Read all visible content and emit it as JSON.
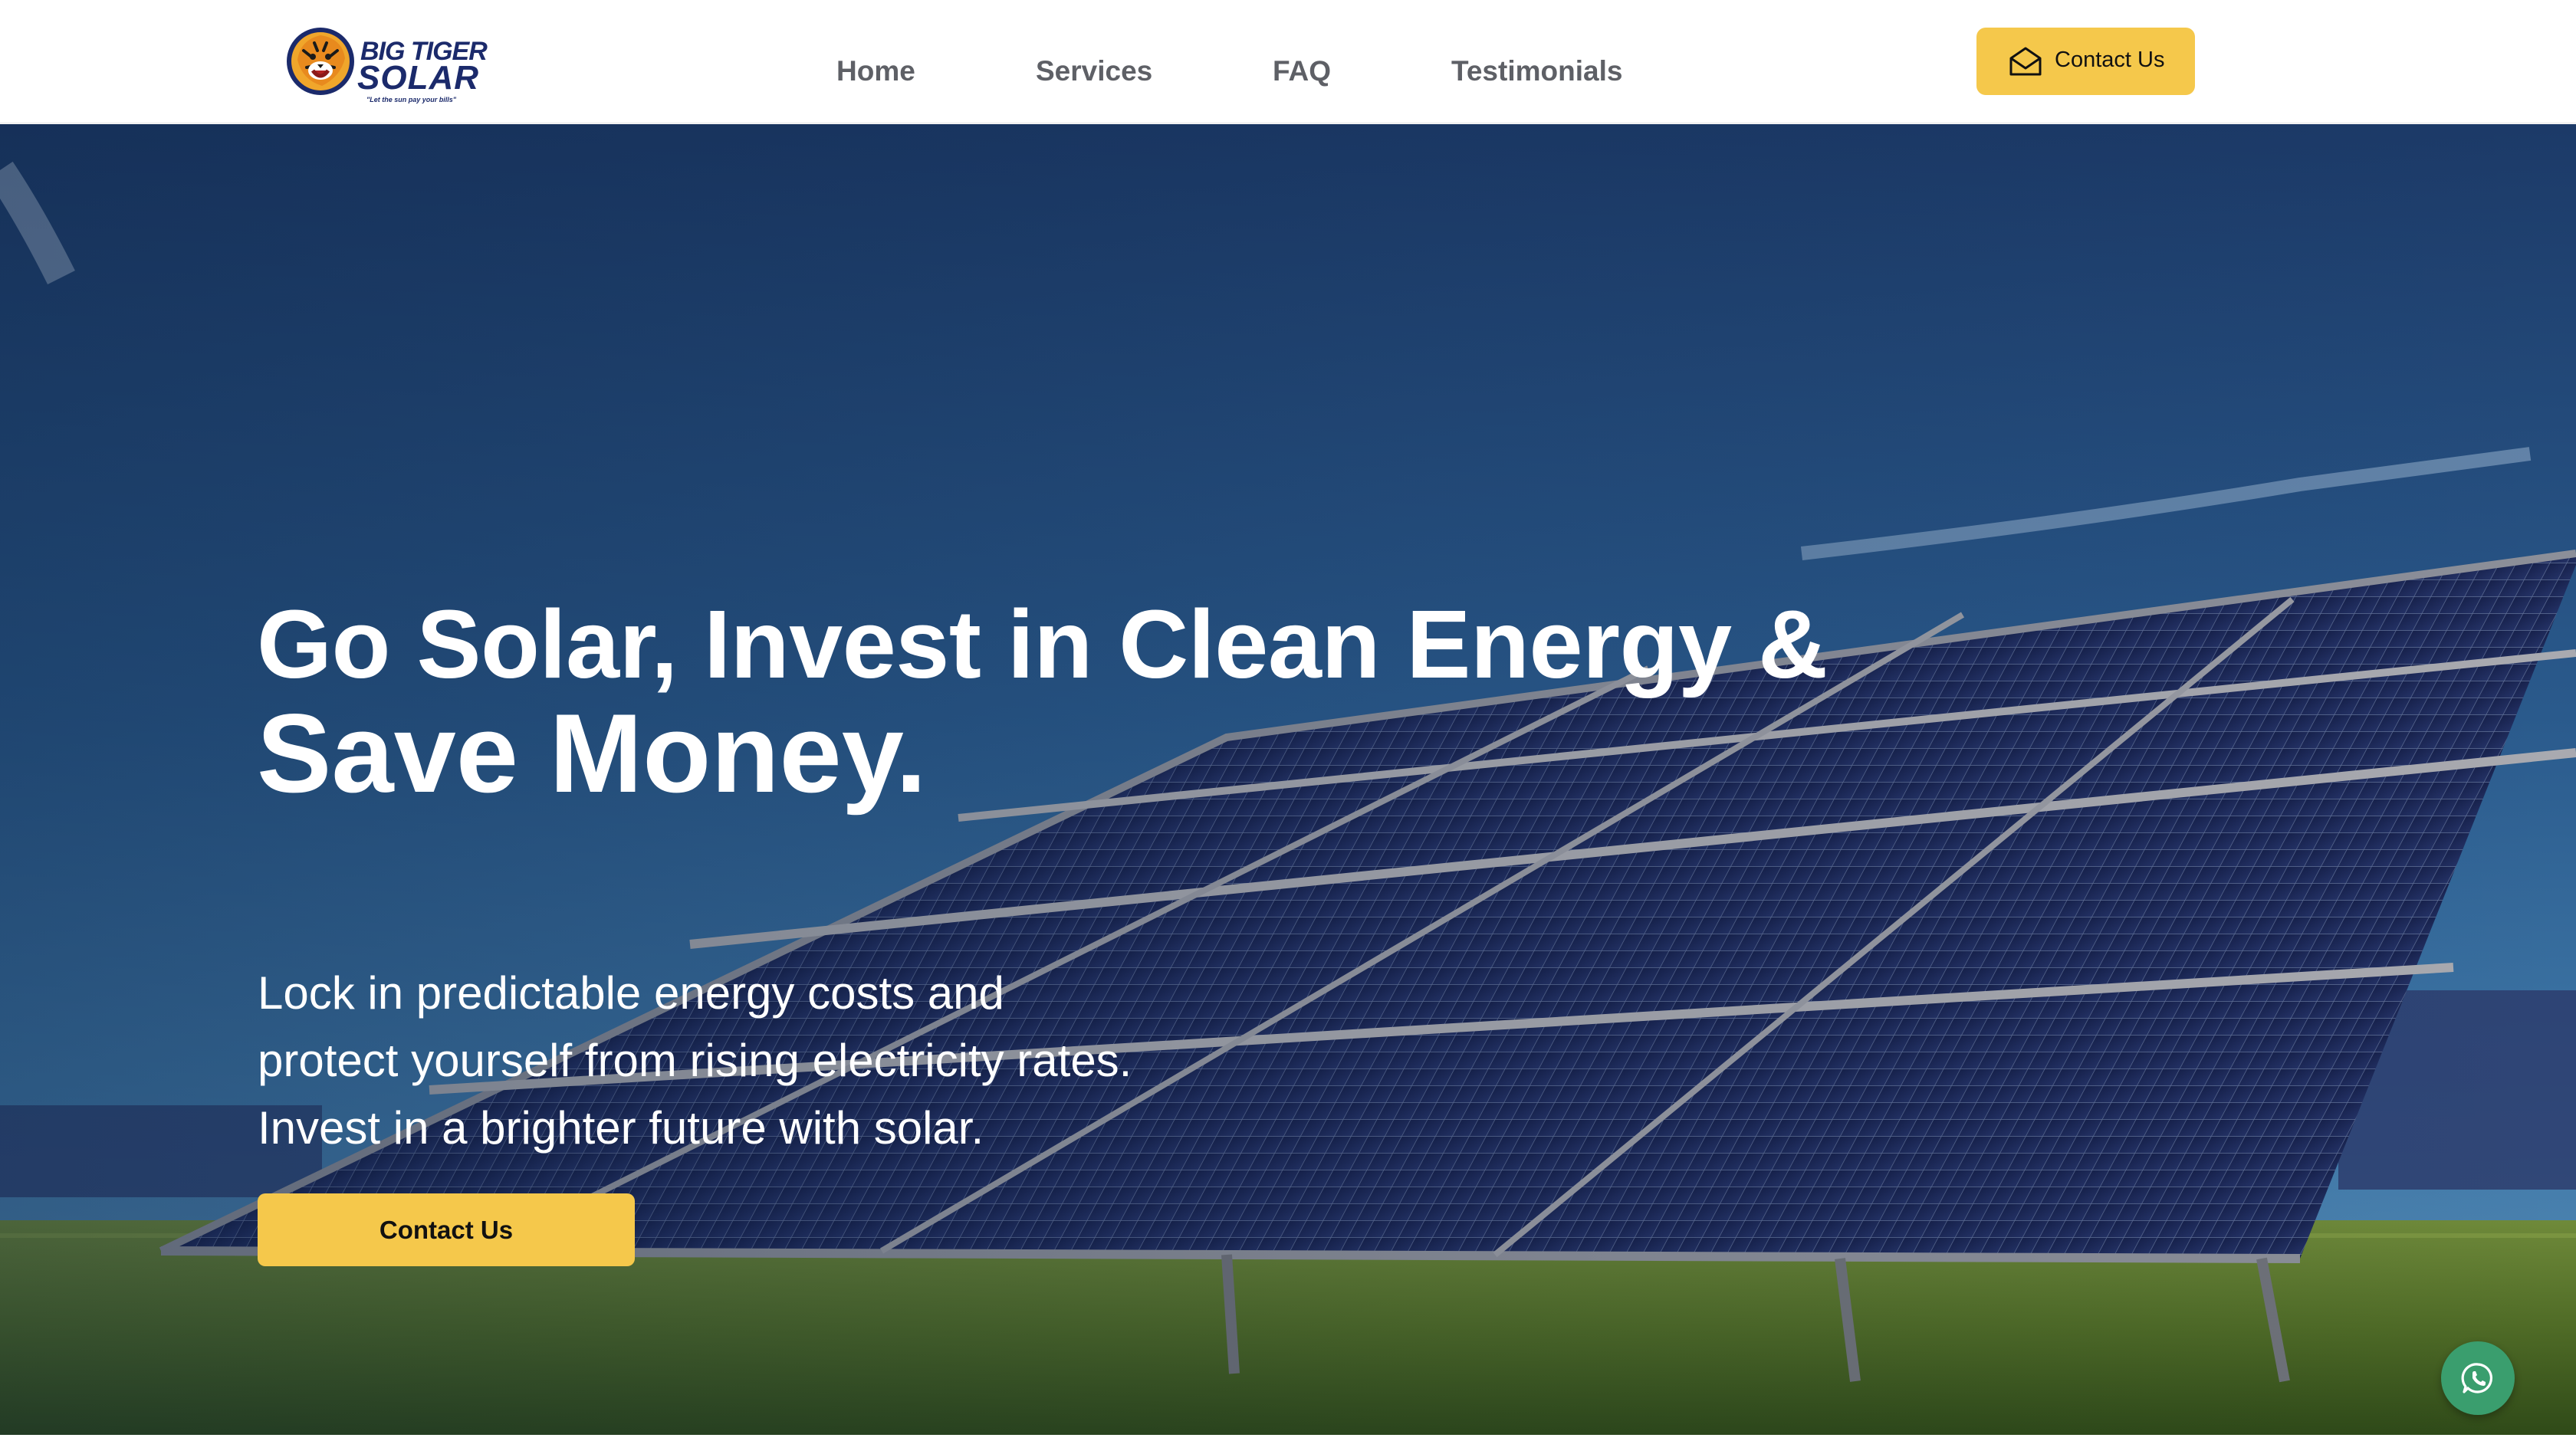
{
  "header": {
    "logo": {
      "line1": "BIG TIGER",
      "line2": "SOLAR",
      "tagline": "\"Let the sun pay your bills\""
    },
    "nav": [
      {
        "label": "Home"
      },
      {
        "label": "Services"
      },
      {
        "label": "FAQ"
      },
      {
        "label": "Testimonials"
      }
    ],
    "cta": {
      "label": "Contact Us",
      "icon": "envelope-icon"
    }
  },
  "hero": {
    "title_line1": "Go Solar, Invest in Clean Energy &",
    "title_line2": "Save Money.",
    "subtitle_lines": [
      "Lock in predictable energy costs and",
      "protect yourself from rising electricity rates.",
      "Invest in a brighter future with solar."
    ],
    "cta_label": "Contact Us",
    "background": "solar panels in a grassy field under a blue sky"
  },
  "floating": {
    "icon": "whatsapp-icon"
  },
  "colors": {
    "accent": "#f5c84b",
    "nav_text": "#5e6066",
    "logo_navy": "#1b2a6b",
    "logo_orange": "#f0a62b",
    "whatsapp_green": "#3a9e6e"
  }
}
